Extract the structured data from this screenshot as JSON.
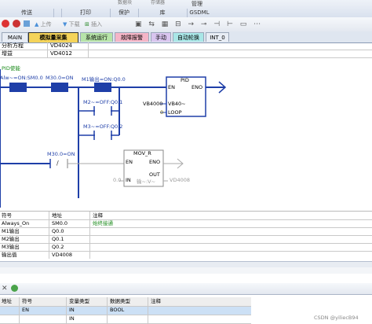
{
  "ribbon": {
    "groups": [
      "传送",
      "",
      "打印",
      "保护",
      "库",
      "GSDML"
    ],
    "top_buttons": [
      "数据块",
      "存储器",
      "管理"
    ],
    "misc": "管理"
  },
  "toolbar": {
    "up_label": "上传",
    "down_label": "下载",
    "insert_label": "插入"
  },
  "tabs": {
    "items": [
      {
        "label": "MAIN",
        "active": false,
        "color": "#e8edf5"
      },
      {
        "label": "模拟量采集",
        "active": true,
        "color": "#f5d45a"
      },
      {
        "label": "系统运行",
        "active": false,
        "color": "#b7e4a9"
      },
      {
        "label": "故障报警",
        "active": false,
        "color": "#f5b5c7"
      },
      {
        "label": "手动",
        "active": false,
        "color": "#d9c5ef"
      },
      {
        "label": "自动轮换",
        "active": false,
        "color": "#a9e7e7"
      },
      {
        "label": "INT_0",
        "active": false,
        "color": "#e8edf5"
      }
    ]
  },
  "prog_table": {
    "rows": [
      {
        "name": "分析方程",
        "value": "VD4024"
      },
      {
        "name": "增益",
        "value": "VD4012"
      }
    ]
  },
  "network": {
    "comment": "PID使能",
    "c1": "Alw~=ON:SM0.0",
    "c2": "M30.0=ON",
    "c3": "M1输出=ON:Q0.0",
    "c4": "M2~=OFF:Q0.1",
    "c5": "M3~=OFF:Q0.2",
    "pid_title": "PID",
    "pid_en": "EN",
    "pid_eno": "ENO",
    "pid_tbl_val": "VB4000",
    "pid_tbl_sym": "VB40~",
    "pid_loop_val": "0",
    "pid_loop": "LOOP",
    "c6": "M30.0=ON",
    "c6_neg": "/",
    "movr_title": "MOV_R",
    "movr_en": "EN",
    "movr_eno": "ENO",
    "movr_in_val": "0.0",
    "movr_in": "IN",
    "movr_out": "OUT",
    "movr_out_val": "输~:V~",
    "movr_out_addr": "VD4008"
  },
  "symbol_table": {
    "headers": [
      "符号",
      "地址",
      "注释"
    ],
    "rows": [
      [
        "Always_On",
        "SM0.0",
        "始终接通"
      ],
      [
        "M1输出",
        "Q0.0",
        ""
      ],
      [
        "M2输出",
        "Q0.1",
        ""
      ],
      [
        "M3输出",
        "Q0.2",
        ""
      ],
      [
        "输出值",
        "VD4008",
        ""
      ]
    ]
  },
  "var_table": {
    "headers": [
      "地址",
      "符号",
      "变量类型",
      "数据类型",
      "注释"
    ],
    "rows": [
      [
        "",
        "EN",
        "IN",
        "BOOL",
        ""
      ],
      [
        "",
        "",
        "IN",
        "",
        ""
      ]
    ]
  },
  "watermark": "CSDN @yiliecB94"
}
